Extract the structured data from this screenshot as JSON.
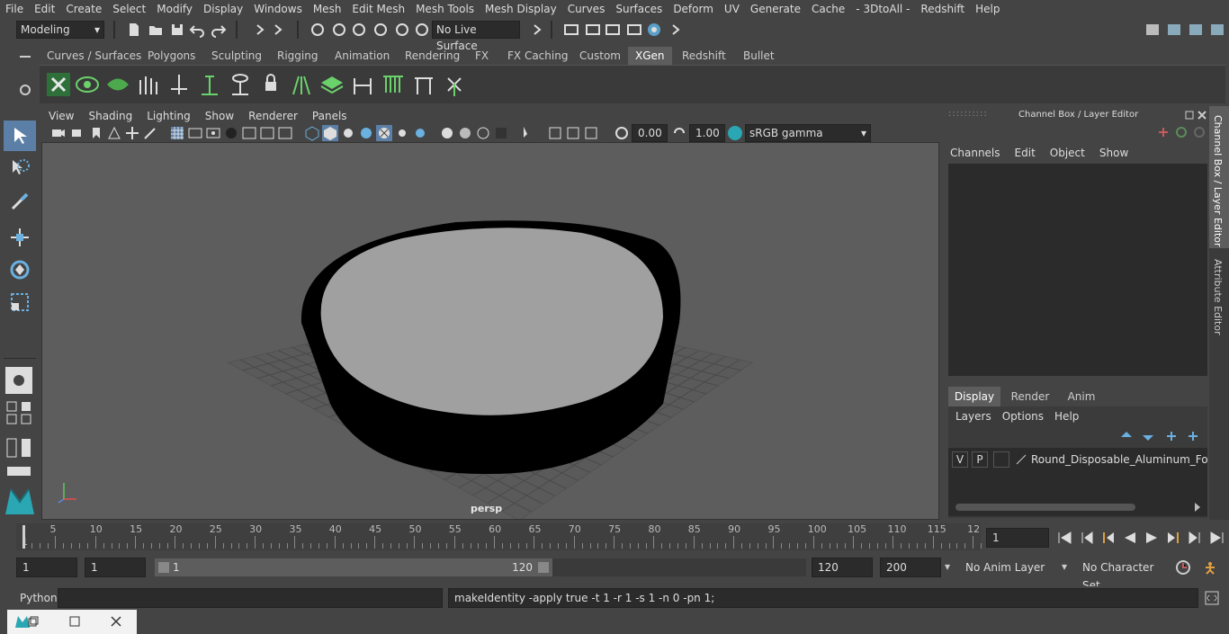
{
  "menu": [
    "File",
    "Edit",
    "Create",
    "Select",
    "Modify",
    "Display",
    "Windows",
    "Mesh",
    "Edit Mesh",
    "Mesh Tools",
    "Mesh Display",
    "Curves",
    "Surfaces",
    "Deform",
    "UV",
    "Generate",
    "Cache",
    "- 3DtoAll -",
    "Redshift",
    "Help"
  ],
  "status": {
    "mode": "Modeling",
    "live_surface": "No Live Surface"
  },
  "shelf": {
    "tabs": [
      "Curves / Surfaces",
      "Polygons",
      "Sculpting",
      "Rigging",
      "Animation",
      "Rendering",
      "FX",
      "FX Caching",
      "Custom",
      "XGen",
      "Redshift",
      "Bullet"
    ],
    "active_tab": "XGen"
  },
  "viewport": {
    "menus": [
      "View",
      "Shading",
      "Lighting",
      "Show",
      "Renderer",
      "Panels"
    ],
    "exposure": "0.00",
    "gamma": "1.00",
    "color_space": "sRGB gamma",
    "camera_label": "persp"
  },
  "channel_box": {
    "title": "Channel Box / Layer Editor",
    "menus": [
      "Channels",
      "Edit",
      "Object",
      "Show"
    ],
    "tabs": [
      "Display",
      "Render",
      "Anim"
    ],
    "active_tab": "Display",
    "layer_menus": [
      "Layers",
      "Options",
      "Help"
    ],
    "layer": {
      "v": "V",
      "p": "P",
      "name": "Round_Disposable_Aluminum_Foil_P"
    }
  },
  "side_tabs": [
    "Channel Box / Layer Editor",
    "Attribute Editor"
  ],
  "timeline": {
    "ticks": [
      "5",
      "10",
      "15",
      "20",
      "25",
      "30",
      "35",
      "40",
      "45",
      "50",
      "55",
      "60",
      "65",
      "70",
      "75",
      "80",
      "85",
      "90",
      "95",
      "100",
      "105",
      "110",
      "115",
      "12"
    ],
    "start_marker": "1",
    "current_frame": "1"
  },
  "range": {
    "start": "1",
    "playback_start": "1",
    "slider_start": "1",
    "slider_end": "120",
    "end": "120",
    "anim_end": "200",
    "anim_layer": "No Anim Layer",
    "char_set": "No Character Set"
  },
  "command": {
    "lang": "Python",
    "output": "makeIdentity -apply true -t 1 -r 1 -s 1 -n 0 -pn 1;"
  }
}
